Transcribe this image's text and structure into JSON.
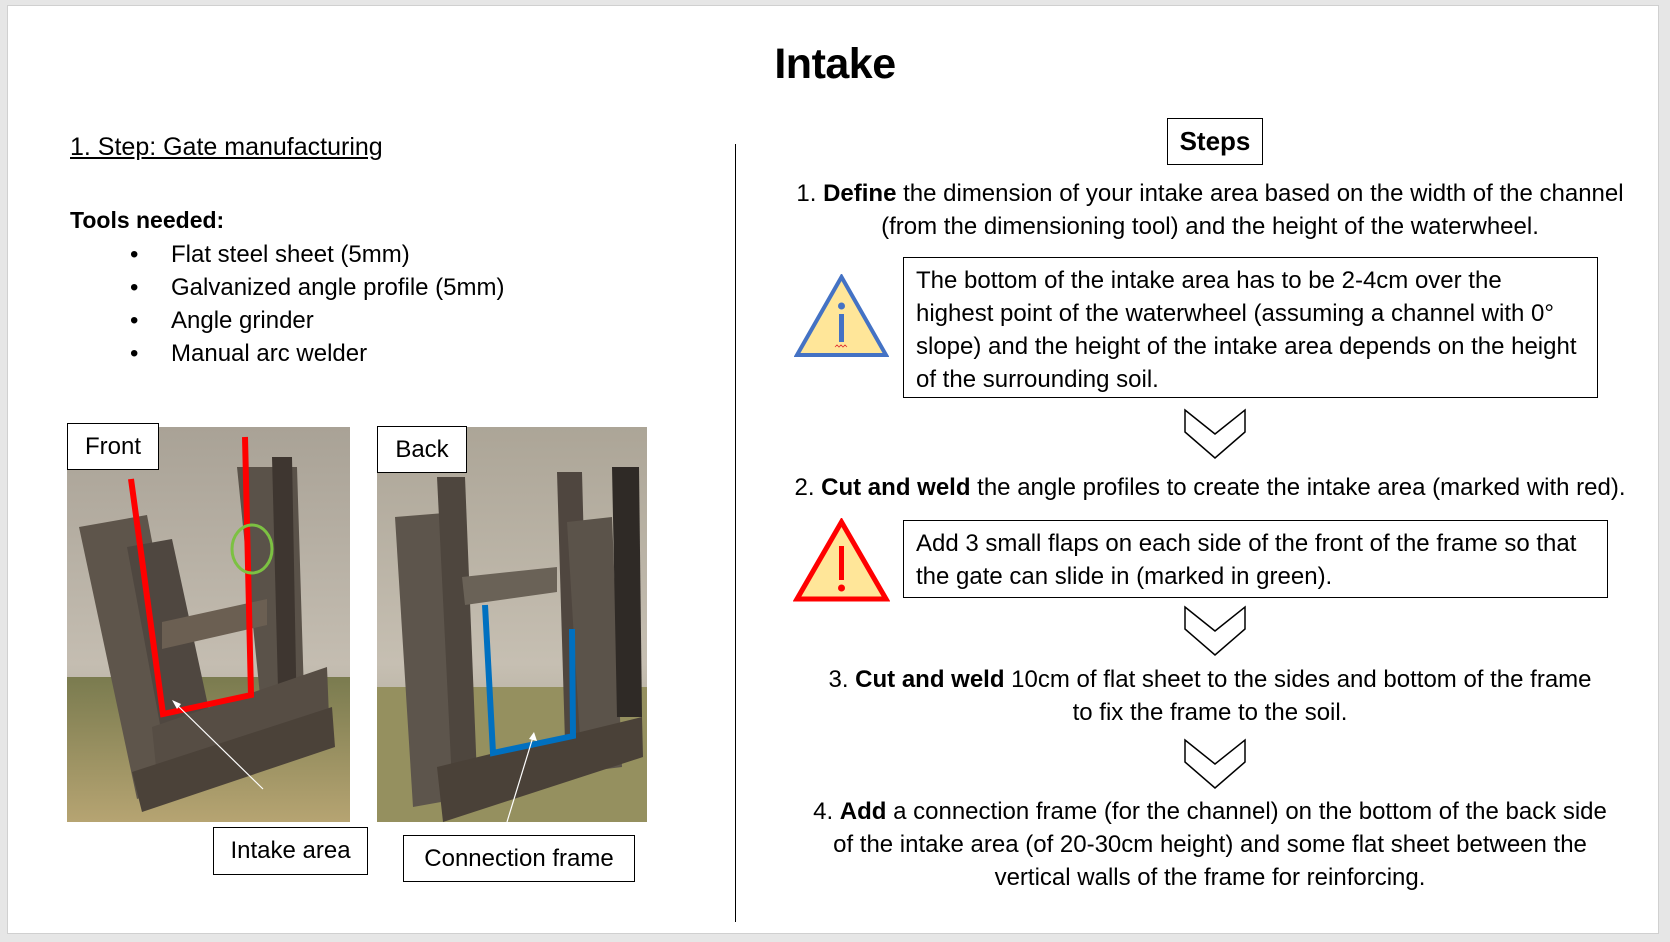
{
  "slide": {
    "title": "Intake",
    "left": {
      "step_heading": "1. Step: Gate manufacturing",
      "tools_title": "Tools needed:",
      "tools": [
        "Flat steel sheet (5mm)",
        "Galvanized angle profile (5mm)",
        "Angle grinder",
        "Manual arc welder"
      ],
      "photos": {
        "front_label": "Front",
        "back_label": "Back",
        "intake_area_label": "Intake area",
        "connection_frame_label": "Connection frame",
        "front_marker_color": "#ff0000",
        "flap_marker_color": "#7cc142",
        "back_marker_color": "#0070c0"
      }
    },
    "right": {
      "steps_heading": "Steps",
      "steps": [
        {
          "num": "1.",
          "bold": "Define",
          "text_line1": " the dimension of your intake area based on the width of the channel",
          "text_line2": "(from the dimensioning tool) and the height of the waterwheel."
        },
        {
          "num": "2.",
          "bold": "Cut and weld",
          "text_line1": " the angle profiles to create the intake area (marked with red).",
          "text_line2": ""
        },
        {
          "num": "3.",
          "bold": "Cut and weld",
          "text_line1": " 10cm of flat sheet to the sides and bottom of the frame",
          "text_line2": "to fix the frame to the soil."
        },
        {
          "num": "4.",
          "bold": "Add",
          "text_line1": " a connection frame (for the channel) on the bottom of the back side",
          "text_line2": "of the intake area (of 20-30cm height) and some flat sheet between the",
          "text_line3": "vertical walls of the frame for reinforcing."
        }
      ],
      "info_note": "The bottom of the intake area has to be 2-4cm over the highest point of the waterwheel (assuming a channel with 0° slope) and the height of the intake area depends on the height of the surrounding soil.",
      "warning_note": "Add 3 small flaps on each side of the front of the frame so that the gate can slide in (marked in green).",
      "info_icon_color": "#4472c4",
      "warning_icon_color": "#ff0000",
      "icon_fill": "#ffe699"
    }
  }
}
